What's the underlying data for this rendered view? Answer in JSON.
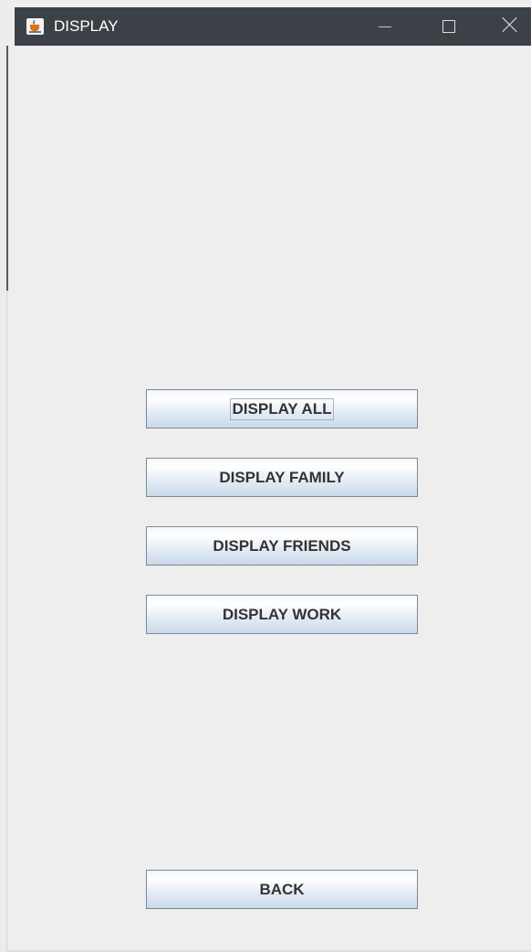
{
  "window": {
    "title": "DISPLAY",
    "app_icon": "java-cup-icon",
    "controls": {
      "minimize_icon": "minimize-icon",
      "maximize_icon": "maximize-icon",
      "close_icon": "close-icon"
    }
  },
  "buttons": {
    "display_all": "DISPLAY ALL",
    "display_family": "DISPLAY FAMILY",
    "display_friends": "DISPLAY FRIENDS",
    "display_work": "DISPLAY WORK",
    "back": "BACK"
  },
  "colors": {
    "titlebar": "#3c4147",
    "background": "#eeeeee",
    "button_border": "#7a8a99"
  }
}
